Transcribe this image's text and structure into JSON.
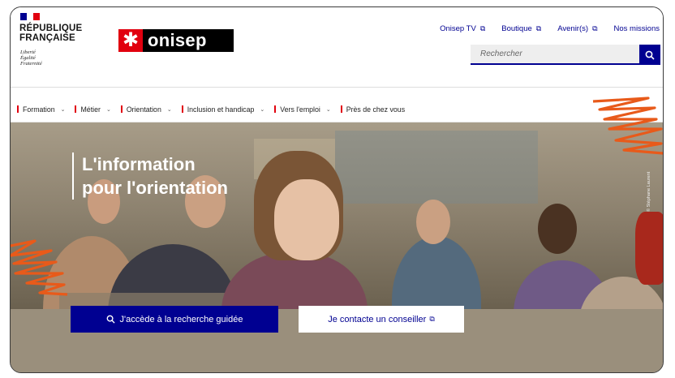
{
  "header": {
    "republique": [
      "RÉPUBLIQUE",
      "FRANÇAISE"
    ],
    "motto": [
      "Liberté",
      "Égalité",
      "Fraternité"
    ],
    "logo_star": "✱",
    "logo_text": "onisep",
    "top_links": [
      {
        "label": "Onisep TV",
        "external": "⧉"
      },
      {
        "label": "Boutique",
        "external": "⧉"
      },
      {
        "label": "Avenir(s)",
        "external": "⧉"
      },
      {
        "label": "Nos missions",
        "external": ""
      }
    ],
    "search": {
      "placeholder": "Rechercher",
      "icon": "search-icon"
    }
  },
  "nav": {
    "items": [
      {
        "label": "Formation",
        "chevron": "⌄"
      },
      {
        "label": "Métier",
        "chevron": "⌄"
      },
      {
        "label": "Orientation",
        "chevron": "⌄"
      },
      {
        "label": "Inclusion et handicap",
        "chevron": "⌄"
      },
      {
        "label": "Vers l'emploi",
        "chevron": "⌄"
      },
      {
        "label": "Près de chez vous",
        "chevron": ""
      }
    ]
  },
  "hero": {
    "headline_line1": "L'information",
    "headline_line2": "pour l'orientation",
    "credit": "© Stéphane Laurent",
    "primary_button": "J'accède à la recherche guidée",
    "secondary_button": "Je contacte un conseiller",
    "secondary_icon": "⧉"
  },
  "colors": {
    "brand_blue": "#000091",
    "brand_red": "#e1000f",
    "scribble_orange": "#e85a1a"
  }
}
